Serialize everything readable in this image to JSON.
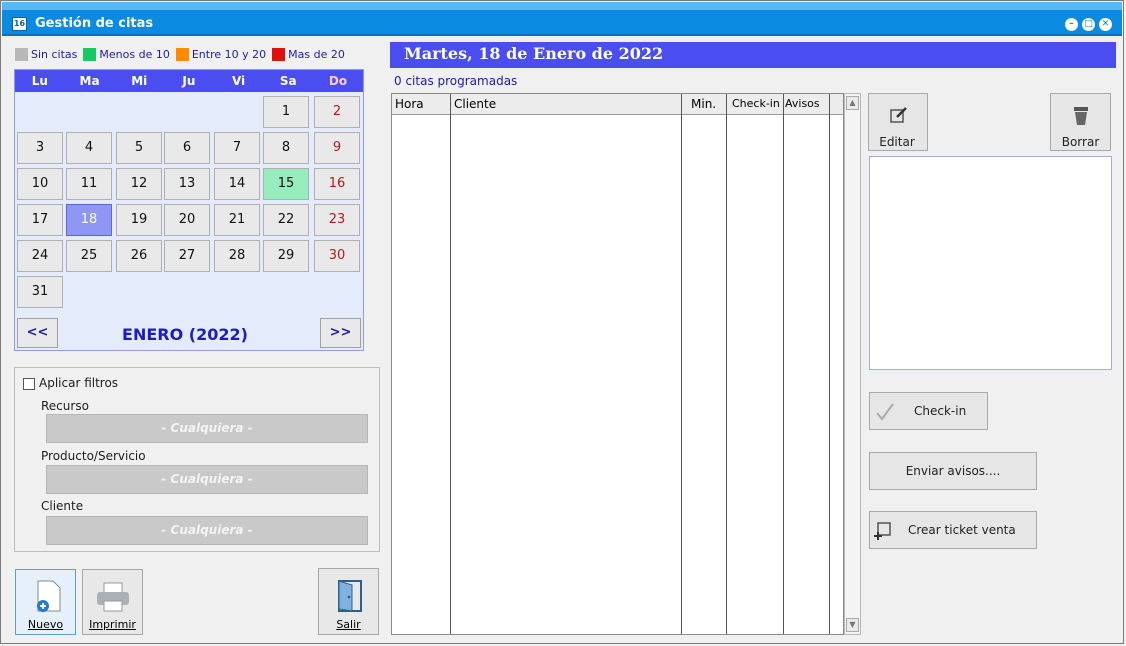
{
  "window": {
    "title": "Gestión de citas",
    "icon_glyph": "16"
  },
  "legend": [
    {
      "label": "Sin citas",
      "color": "#b8b8b8"
    },
    {
      "label": "Menos de 10",
      "color": "#17c960"
    },
    {
      "label": "Entre 10 y 20",
      "color": "#ff8c00"
    },
    {
      "label": "Mas de 20",
      "color": "#e01010"
    }
  ],
  "calendar": {
    "weekdays": [
      "Lu",
      "Ma",
      "Mi",
      "Ju",
      "Vi",
      "Sa",
      "Do"
    ],
    "month_label": "ENERO  (2022)",
    "prev_label": "<<",
    "next_label": ">>",
    "days": [
      "1",
      "2",
      "3",
      "4",
      "5",
      "6",
      "7",
      "8",
      "9",
      "10",
      "11",
      "12",
      "13",
      "14",
      "15",
      "16",
      "17",
      "18",
      "19",
      "20",
      "21",
      "22",
      "23",
      "24",
      "25",
      "26",
      "27",
      "28",
      "29",
      "30",
      "31"
    ],
    "today": "15",
    "selected": "18"
  },
  "filters": {
    "apply_label": "Aplicar filtros",
    "recurso_label": "Recurso",
    "recurso_value": "- Cualquiera -",
    "producto_label": "Producto/Servicio",
    "producto_value": "- Cualquiera -",
    "cliente_label": "Cliente",
    "cliente_value": "- Cualquiera -"
  },
  "bottom_buttons": {
    "nuevo": "Nuevo",
    "imprimir": "Imprimir",
    "salir": "Salir"
  },
  "day_header": "Martes, 18 de Enero de 2022",
  "appointment_count": "0 citas programadas",
  "table": {
    "columns": [
      "Hora",
      "Cliente",
      "Min.",
      "Check-in",
      "Avisos"
    ]
  },
  "actions": {
    "editar": "Editar",
    "borrar": "Borrar",
    "checkin": "Check-in",
    "enviar_avisos": "Enviar avisos....",
    "crear_ticket": "Crear ticket venta"
  }
}
